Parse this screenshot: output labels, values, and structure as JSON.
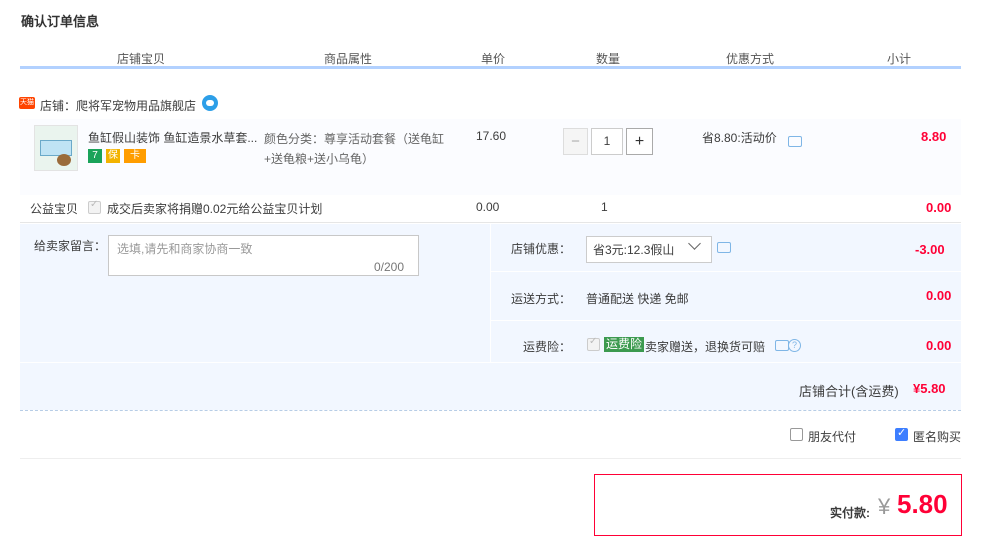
{
  "page_title": "确认订单信息",
  "columns": [
    "店铺宝贝",
    "商品属性",
    "单价",
    "数量",
    "优惠方式",
    "小计"
  ],
  "shop": {
    "badge": "天猫",
    "name": "店铺：爬将军宠物用品旗舰店"
  },
  "item": {
    "name": "鱼缸假山装饰 鱼缸造景水草套...",
    "badges": [
      "7",
      "保",
      "卡"
    ],
    "property": "颜色分类：尊享活动套餐（送龟缸+送龟粮+送小乌龟）",
    "unit_price": "17.60",
    "quantity": "1",
    "minus": "−",
    "plus": "+",
    "promo": "省8.80:活动价",
    "subtotal": "8.80"
  },
  "charity": {
    "label": "公益宝贝",
    "text": "成交后卖家将捐赠0.02元给公益宝贝计划",
    "price": "0.00",
    "qty": "1",
    "subtotal": "0.00"
  },
  "message": {
    "label": "给卖家留言：",
    "placeholder": "选填,请先和商家协商一致",
    "counter": "0/200"
  },
  "shop_discount": {
    "label": "店铺优惠：",
    "selected": "省3元:12.3假山",
    "amount": "-3.00"
  },
  "shipping": {
    "label": "运送方式：",
    "value": "普通配送 快递 免邮",
    "amount": "0.00"
  },
  "insurance": {
    "label": "运费险：",
    "tag": "运费险",
    "text": "卖家赠送，退换货可赔",
    "amount": "0.00"
  },
  "shop_total": {
    "label": "店铺合计(含运费)",
    "amount": "¥5.80"
  },
  "options": {
    "friend_pay": "朋友代付",
    "anonymous": "匿名购买",
    "anonymous_checked": true,
    "friend_checked": false
  },
  "payment": {
    "label": "实付款:",
    "currency": "¥",
    "amount": "5.80"
  },
  "colors": {
    "accent_red": "#ff0036",
    "header_line": "#b2d1ff",
    "panel_bg": "#f2f7ff"
  }
}
